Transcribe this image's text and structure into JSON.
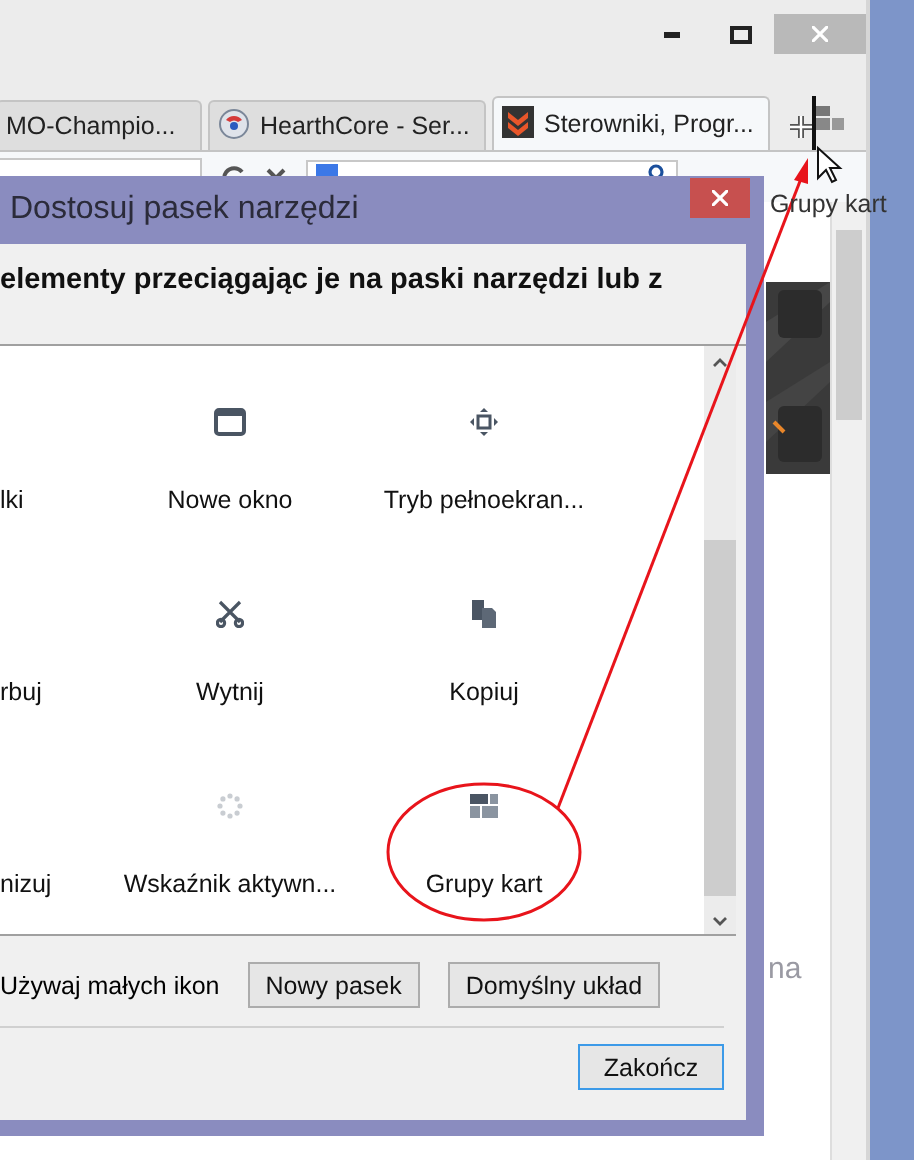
{
  "tabs": [
    {
      "title": "MO-Champio...",
      "kind": "none",
      "selected": false
    },
    {
      "title": "HearthCore - Ser...",
      "kind": "globe",
      "selected": false
    },
    {
      "title": "Sterowniki, Progr...",
      "kind": "chevrons",
      "selected": true
    }
  ],
  "drag_label": "Grupy kart",
  "page_text": "na",
  "dialog": {
    "title": "Dostosuj pasek narzędzi",
    "instructions": "elementy przeciągając je na paski narzędzi lub z",
    "items": [
      {
        "label": "lki",
        "kind": "none"
      },
      {
        "label": "Nowe okno",
        "kind": "window"
      },
      {
        "label": "Tryb pełnoekran...",
        "kind": "fullscreen"
      },
      {
        "label": "rbuj",
        "kind": "none"
      },
      {
        "label": "Wytnij",
        "kind": "scissors"
      },
      {
        "label": "Kopiuj",
        "kind": "copy"
      },
      {
        "label": "nizuj",
        "kind": "none"
      },
      {
        "label": "Wskaźnik aktywn...",
        "kind": "spinner"
      },
      {
        "label": "Grupy kart",
        "kind": "tabgroups"
      }
    ],
    "small_icons_label": "Używaj małych ikon",
    "buttons": [
      "Nowy pasek",
      "Domyślny układ"
    ],
    "done": "Zakończ"
  }
}
